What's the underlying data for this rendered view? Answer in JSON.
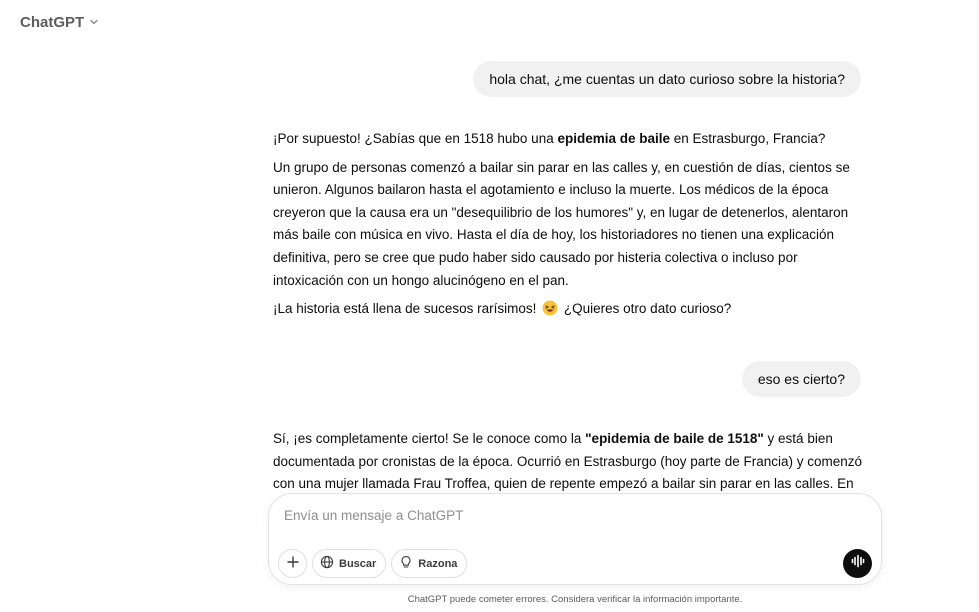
{
  "header": {
    "model_label": "ChatGPT"
  },
  "thread": {
    "user_message_1": "hola chat, ¿me cuentas un dato curioso sobre la historia?",
    "assistant_1": {
      "p1_a": "¡Por supuesto! ¿Sabías que en 1518 hubo una ",
      "p1_bold": "epidemia de baile",
      "p1_b": " en Estrasburgo, Francia?",
      "p2": "Un grupo de personas comenzó a bailar sin parar en las calles y, en cuestión de días, cientos se unieron. Algunos bailaron hasta el agotamiento e incluso la muerte. Los médicos de la época creyeron que la causa era un \"desequilibrio de los humores\" y, en lugar de detenerlos, alentaron más baile con música en vivo. Hasta el día de hoy, los historiadores no tienen una explicación definitiva, pero se cree que pudo haber sido causado por histeria colectiva o incluso por intoxicación con un hongo alucinógeno en el pan.",
      "p3_a": "¡La historia está llena de sucesos rarísimos!",
      "p3_emoji": "laughing-emoji",
      "p3_b": "¿Quieres otro dato curioso?"
    },
    "user_message_2": "eso es cierto?",
    "assistant_2": {
      "p1_a": "Sí, ¡es completamente cierto! Se le conoce como la ",
      "p1_bold": "\"epidemia de baile de 1518\"",
      "p1_b": " y está bien documentada por cronistas de la época. Ocurrió en Estrasburgo (hoy parte de Francia) y comenzó con una mujer llamada Frau Troffea, quien de repente empezó a bailar sin parar en las calles. En el"
    }
  },
  "composer": {
    "placeholder": "Envía un mensaje a ChatGPT",
    "value": "",
    "tools": {
      "attach_icon": "plus-icon",
      "search_label": "Buscar",
      "search_icon": "globe-icon",
      "reason_label": "Razona",
      "reason_icon": "lightbulb-icon",
      "voice_icon": "voice-waveform-icon"
    }
  },
  "footer": {
    "disclaimer": "ChatGPT puede cometer errores. Considera verificar la información importante."
  }
}
